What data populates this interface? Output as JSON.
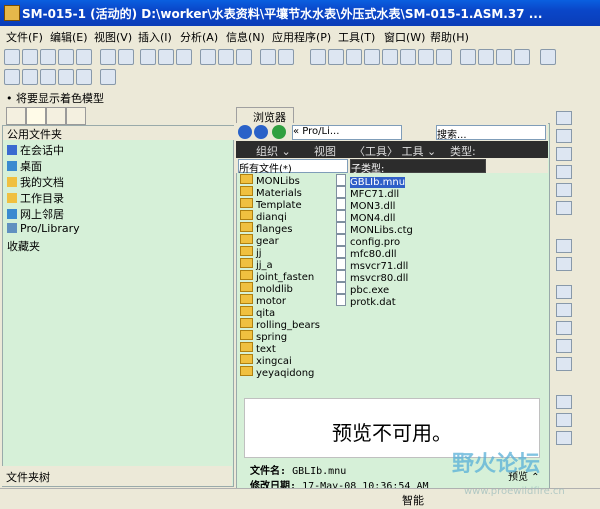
{
  "window": {
    "title": "SM-015-1 (活动的) D:\\worker\\水表资料\\平壤节水水表\\外压式水表\\SM-015-1.ASM.37 ..."
  },
  "menu": [
    "文件(F)",
    "编辑(E)",
    "视图(V)",
    "插入(I)",
    "分析(A)",
    "信息(N)",
    "应用程序(P)",
    "工具(T)",
    "窗口(W)",
    "帮助(H)"
  ],
  "message": "• 将要显示着色模型",
  "navigator": {
    "header": "公用文件夹",
    "items": [
      "在会话中",
      "桌面",
      "我的文档",
      "工作目录",
      "网上邻居",
      "Pro/Library",
      "收藏夹"
    ],
    "footer": "文件夹树"
  },
  "browser": {
    "tab_label": "浏览器",
    "address": "« Pro/Li...",
    "search_placeholder": "搜索...",
    "toolbar": {
      "organize": "组织 ⌄",
      "view": "视图",
      "tools": "〈工具〉 工具 ⌄",
      "type": "类型:"
    },
    "filter": {
      "all_files": "所有文件(*)",
      "subtype": "子类型:"
    },
    "folders": [
      "MONLibs",
      "Materials",
      "Template",
      "dianqi",
      "flanges",
      "gear",
      "jj",
      "jj_a",
      "joint_fasten",
      "moldlib",
      "motor",
      "qita",
      "rolling_bears",
      "spring",
      "text",
      "xingcai",
      "yeyaqidong"
    ],
    "files": [
      "GBLIb.mnu",
      "MFC71.dll",
      "MON3.dll",
      "MON4.dll",
      "MONLibs.ctg",
      "config.pro",
      "mfc80.dll",
      "msvcr71.dll",
      "msvcr80.dll",
      "pbc.exe",
      "protk.dat"
    ],
    "selected_file": "GBLIb.mnu",
    "preview_text": "预览不可用。",
    "info": {
      "filename_label": "文件名:",
      "filename": "GBLIb.mnu",
      "modified_label": "修改日期:",
      "modified": "17-May-08 10:36:54 AM"
    },
    "preview_button": "预览 ⌃"
  },
  "status": {
    "mode": "智能"
  },
  "watermark": {
    "main": "野火论坛",
    "url": "www.proewildfire.cn"
  }
}
